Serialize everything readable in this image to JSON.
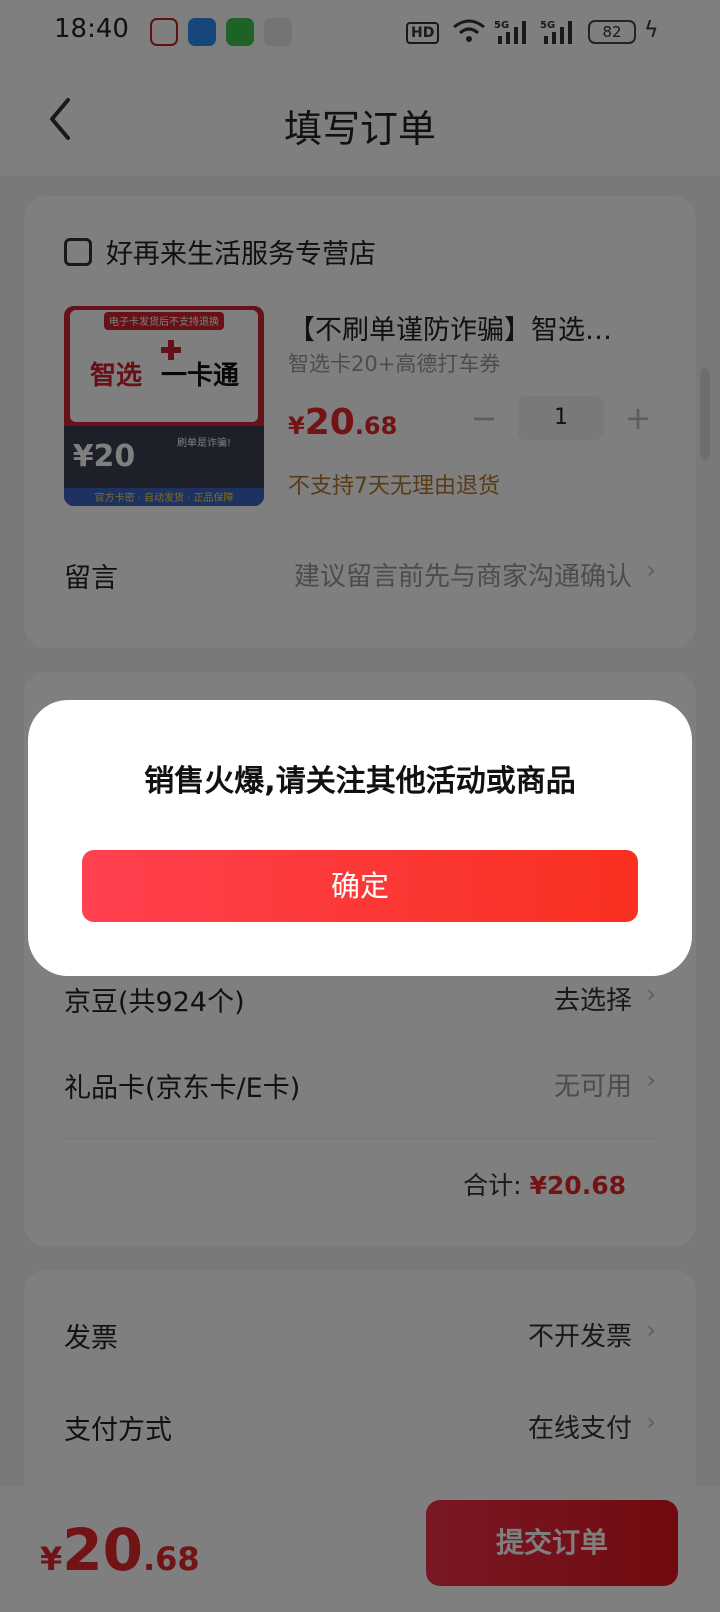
{
  "status_bar": {
    "time": "18:40",
    "battery": "82",
    "network": "5G",
    "hd_label": "HD"
  },
  "header": {
    "title": "填写订单"
  },
  "store": {
    "name": "好再来生活服务专营店"
  },
  "product": {
    "name": "【不刷单谨防诈骗】智选…",
    "spec": "智选卡20+高德打车券",
    "price_currency": "¥",
    "price_int": "20",
    "price_dec": ".68",
    "quantity": "1",
    "minus": "−",
    "plus": "+",
    "return_policy": "不支持7天无理由退货",
    "image_text": {
      "top_banner": "电子卡发货后不支持退换",
      "brand_a": "智选",
      "brand_b": "一卡通",
      "face_value": "¥20",
      "warning": "刷单是诈骗!",
      "bottom_banner": "官方卡密 · 自动发货 · 正品保障"
    }
  },
  "message_row": {
    "label": "留言",
    "placeholder": "建议留言前先与商家沟通确认"
  },
  "jingdou_row": {
    "label": "京豆(共924个)",
    "value": "去选择"
  },
  "giftcard_row": {
    "label": "礼品卡(京东卡/E卡)",
    "value": "无可用"
  },
  "subtotal": {
    "label": "合计:",
    "amount": "¥20.68"
  },
  "invoice_row": {
    "label": "发票",
    "value": "不开发票"
  },
  "payment_row": {
    "label": "支付方式",
    "value": "在线支付"
  },
  "bottom": {
    "price_currency": "¥",
    "price_int": "20",
    "price_dec": ".68",
    "submit_label": "提交订单"
  },
  "dialog": {
    "message": "销售火爆,请关注其他活动或商品",
    "confirm_label": "确定"
  },
  "icons": {
    "back": "chevron-left-icon",
    "chevron": "chevron-right-icon",
    "store": "store-icon"
  },
  "colors": {
    "accent": "#e5262b",
    "dialog_button": "#ff4150",
    "return_policy": "#b5762f"
  }
}
